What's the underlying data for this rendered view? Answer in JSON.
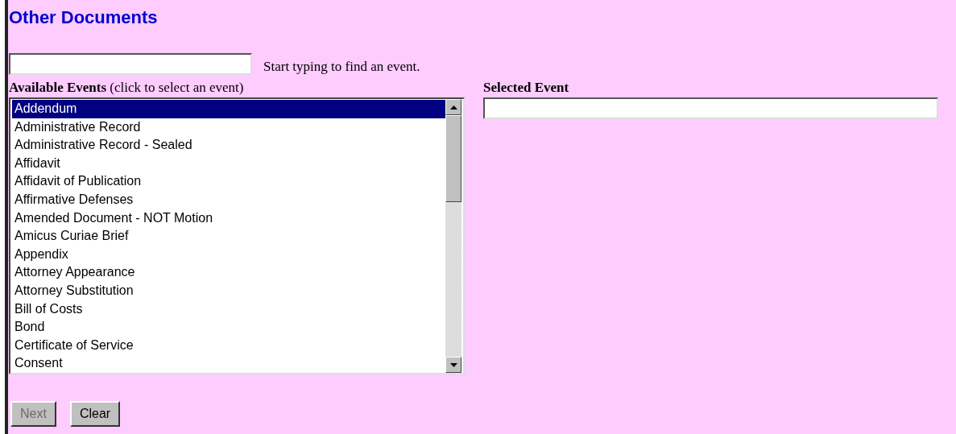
{
  "title": "Other Documents",
  "search": {
    "hint": "Start typing to find an event."
  },
  "available_events": {
    "label": "Available Events",
    "note": "(click to select an event)",
    "items": [
      {
        "label": "Addendum",
        "selected": true
      },
      {
        "label": "Administrative Record",
        "selected": false
      },
      {
        "label": "Administrative Record - Sealed",
        "selected": false
      },
      {
        "label": "Affidavit",
        "selected": false
      },
      {
        "label": "Affidavit of Publication",
        "selected": false
      },
      {
        "label": "Affirmative Defenses",
        "selected": false
      },
      {
        "label": "Amended Document - NOT Motion",
        "selected": false
      },
      {
        "label": "Amicus Curiae Brief",
        "selected": false
      },
      {
        "label": "Appendix",
        "selected": false
      },
      {
        "label": "Attorney Appearance",
        "selected": false
      },
      {
        "label": "Attorney Substitution",
        "selected": false
      },
      {
        "label": "Bill of Costs",
        "selected": false
      },
      {
        "label": "Bond",
        "selected": false
      },
      {
        "label": "Certificate of Service",
        "selected": false
      },
      {
        "label": "Consent",
        "selected": false
      }
    ]
  },
  "selected_event": {
    "label": "Selected Event"
  },
  "buttons": [
    {
      "label": "Next",
      "disabled": true
    },
    {
      "label": "Clear",
      "disabled": false
    }
  ]
}
